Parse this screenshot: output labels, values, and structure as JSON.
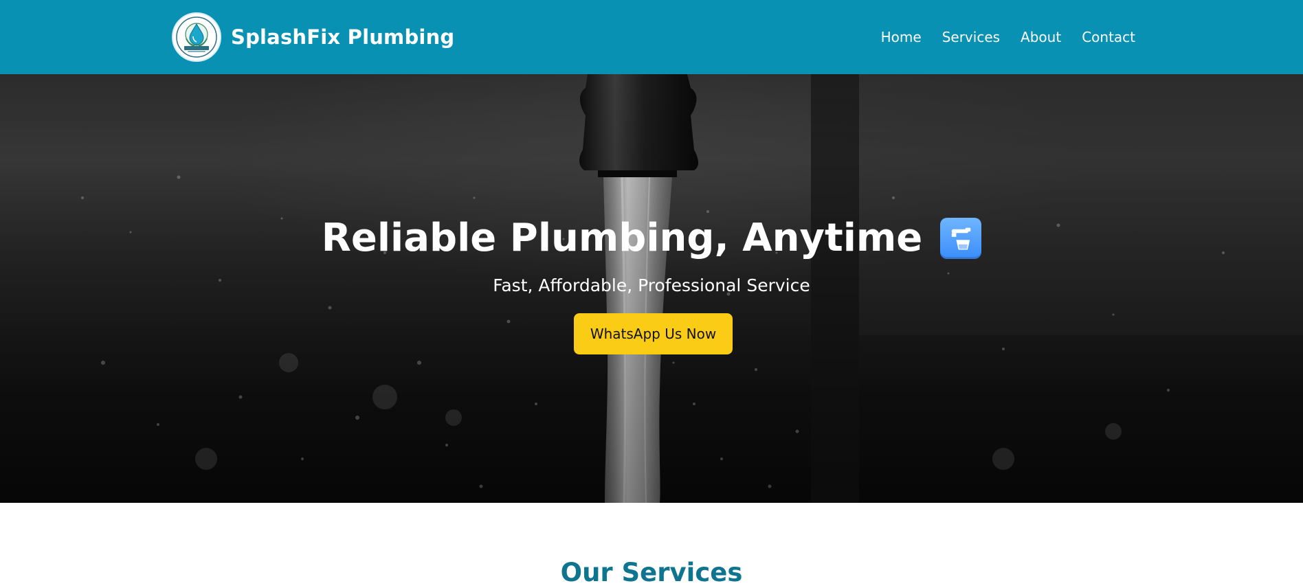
{
  "header": {
    "brand_name": "SplashFix Plumbing",
    "logo_text": "COMPANY NAME",
    "nav": [
      {
        "label": "Home"
      },
      {
        "label": "Services"
      },
      {
        "label": "About"
      },
      {
        "label": "Contact"
      }
    ],
    "background_color": "#0891b2"
  },
  "hero": {
    "title": "Reliable Plumbing, Anytime",
    "title_icon": "potable-water-faucet-icon",
    "subtitle": "Fast, Affordable, Professional Service",
    "cta_label": "WhatsApp Us Now",
    "cta_color": "#facc15"
  },
  "services": {
    "heading": "Our Services",
    "heading_color": "#0e7490"
  }
}
